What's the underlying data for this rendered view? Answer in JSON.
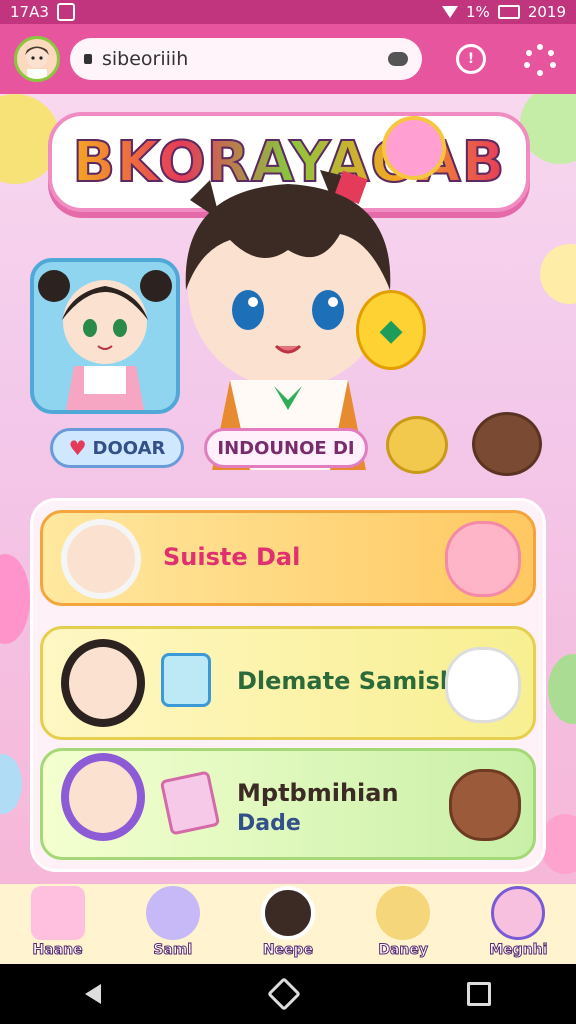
{
  "status_bar": {
    "time": "17A3",
    "right_text": "2019",
    "percent": "1%"
  },
  "browser": {
    "url": "sibeoriiih"
  },
  "logo": {
    "text": "BKORAYAOAB"
  },
  "badges": {
    "left": "DOOAR",
    "right": "INDOUNOE DI"
  },
  "cards": {
    "card1": {
      "title": "Suiste Dal"
    },
    "card2": {
      "title": "Dlemate Samisl"
    },
    "card3": {
      "title_line1": "Mptbmihian",
      "title_line2": "Dade"
    }
  },
  "bottom_nav": [
    {
      "label": "Haane",
      "icon": "house-icon"
    },
    {
      "label": "Saml",
      "icon": "character-icon"
    },
    {
      "label": "Neepe",
      "icon": "character-icon"
    },
    {
      "label": "Daney",
      "icon": "character-icon"
    },
    {
      "label": "Megnhi",
      "icon": "character-icon"
    }
  ],
  "colors": {
    "accent": "#e8559f",
    "status_bar": "#c0357d",
    "card1": "#ffc861",
    "card2": "#f8ef91",
    "card3": "#c9f0a8"
  }
}
